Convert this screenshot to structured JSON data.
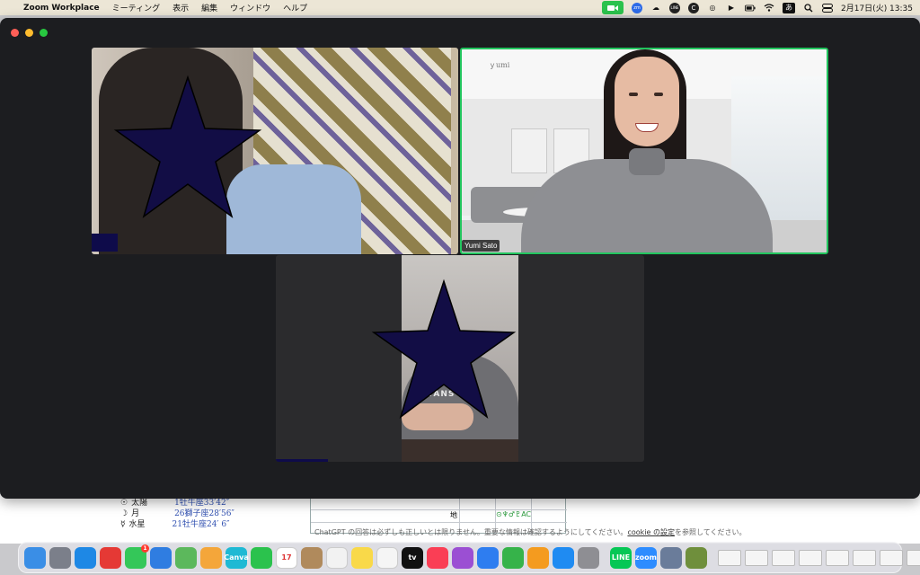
{
  "menubar": {
    "app_name": "Zoom Workplace",
    "menus": [
      "ミーティング",
      "表示",
      "編集",
      "ウィンドウ",
      "ヘルプ"
    ],
    "zoom_text": "zm",
    "line_text": "LINE",
    "c_text": "C",
    "ime_text": "あ",
    "datetime": "2月17日(火) 13:35"
  },
  "participants": {
    "p2_name": "Yumi Sato"
  },
  "tile2": {
    "ceiling_text": "ｙumi"
  },
  "tile3": {
    "shirt_text": "VANS"
  },
  "background_doc": {
    "rows": [
      {
        "symbol": "☉",
        "label": "太陽",
        "value": "1牡牛座33′42″"
      },
      {
        "symbol": "☽",
        "label": "月",
        "value": "26獅子座28′56″"
      },
      {
        "symbol": "☿",
        "label": "水星",
        "value": "21牡牛座24′ 6″"
      }
    ],
    "grid_label": "地",
    "grid_cell_symbols": "⊙♆♂♇AC",
    "notice_text": "ChatGPT の回答は必ずしも正しいとは限りません。重要な情報は確認するようにしてください。",
    "notice_link": "cookie の設定",
    "notice_tail": "を参照してください。"
  },
  "dock": {
    "items": [
      {
        "name": "finder",
        "color": "#3a8ee6",
        "label": ""
      },
      {
        "name": "launchpad",
        "color": "#7b7f8a",
        "label": ""
      },
      {
        "name": "safari",
        "color": "#1e88e5",
        "label": ""
      },
      {
        "name": "chrome",
        "color": "#e53935",
        "label": ""
      },
      {
        "name": "messages",
        "color": "#34c759",
        "label": "",
        "badge": "1"
      },
      {
        "name": "mail",
        "color": "#2f7de1",
        "label": ""
      },
      {
        "name": "maps",
        "color": "#5cb85c",
        "label": ""
      },
      {
        "name": "photos",
        "color": "#f4a63a",
        "label": ""
      },
      {
        "name": "canva",
        "color": "#1fb9d4",
        "label": "Canva"
      },
      {
        "name": "facetime",
        "color": "#2bc24d",
        "label": ""
      },
      {
        "name": "calendar",
        "color": "#ffffff",
        "label": "17"
      },
      {
        "name": "contacts",
        "color": "#b08a5c",
        "label": ""
      },
      {
        "name": "reminders",
        "color": "#f2f2f2",
        "label": ""
      },
      {
        "name": "notes",
        "color": "#f9d949",
        "label": ""
      },
      {
        "name": "freeform",
        "color": "#f5f5f5",
        "label": ""
      },
      {
        "name": "tv",
        "color": "#111111",
        "label": "tv"
      },
      {
        "name": "music",
        "color": "#fa3e55",
        "label": ""
      },
      {
        "name": "podcasts",
        "color": "#9b4fd3",
        "label": ""
      },
      {
        "name": "keynote",
        "color": "#2e7df0",
        "label": ""
      },
      {
        "name": "numbers",
        "color": "#36b34a",
        "label": ""
      },
      {
        "name": "pages",
        "color": "#f49b1f",
        "label": ""
      },
      {
        "name": "app-store",
        "color": "#1f8bf2",
        "label": ""
      },
      {
        "name": "system-settings",
        "color": "#8e8e93",
        "label": ""
      },
      {
        "name": "line",
        "color": "#06c755",
        "label": "LINE"
      },
      {
        "name": "zoom",
        "color": "#2d8cff",
        "label": "zoom"
      },
      {
        "name": "preview",
        "color": "#6a7c9a",
        "label": ""
      },
      {
        "name": "crown-app",
        "color": "#6f8f3c",
        "label": ""
      }
    ],
    "thumb_count": 8
  }
}
